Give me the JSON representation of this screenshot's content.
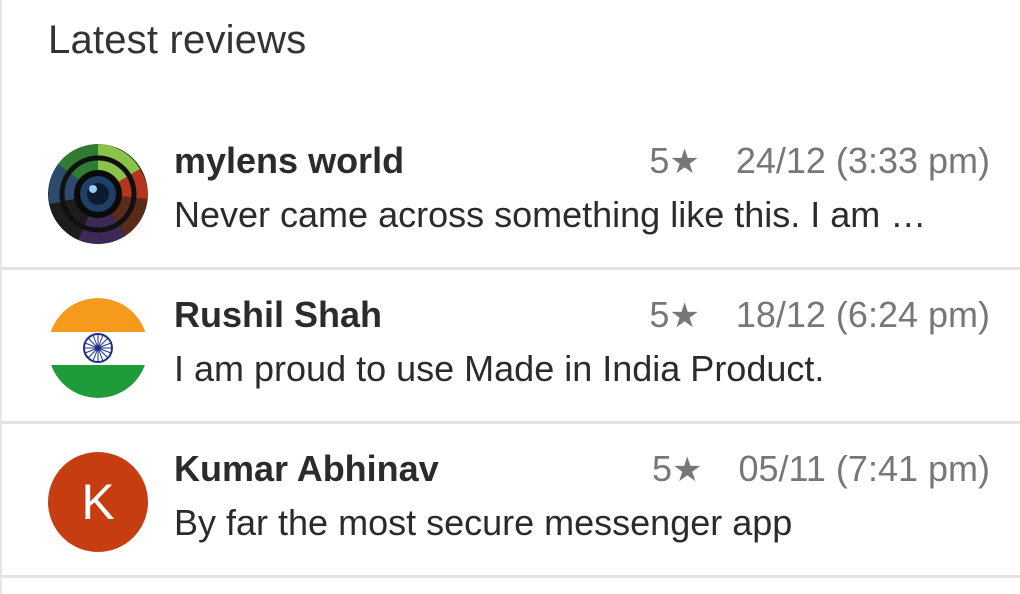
{
  "section": {
    "title": "Latest reviews"
  },
  "reviews": [
    {
      "name": "mylens world",
      "rating": "5",
      "star": "★",
      "date": "24/12 (3:33 pm)",
      "text": "Never came across something like this. I am …",
      "avatar": "camera-lens-icon"
    },
    {
      "name": "Rushil Shah",
      "rating": "5",
      "star": "★",
      "date": "18/12 (6:24 pm)",
      "text": "I am proud to use Made in India Product.",
      "avatar": "india-flag-icon"
    },
    {
      "name": "Kumar Abhinav",
      "rating": "5",
      "star": "★",
      "date": "05/11 (7:41 pm)",
      "text": "By far the most secure messenger app",
      "avatar_letter": "K",
      "avatar_color": "#c63d12"
    }
  ]
}
